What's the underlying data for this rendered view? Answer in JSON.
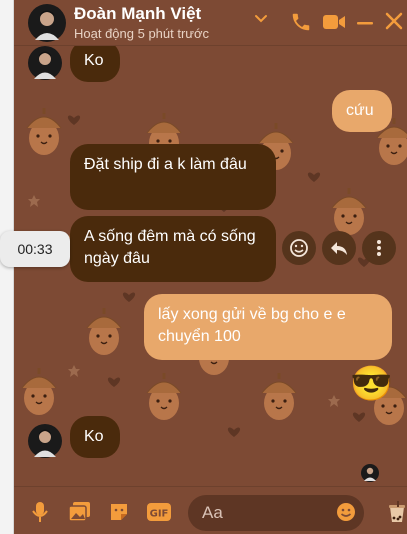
{
  "header": {
    "name": "Đoàn Mạnh Việt",
    "status": "Hoạt động 5 phút trước"
  },
  "colors": {
    "background": "#7d4a34",
    "incoming_bubble": "#4a2a0c",
    "outgoing_bubble": "#e8a86b",
    "accent": "#f39c3c"
  },
  "messages": [
    {
      "direction": "in",
      "text": "Ko"
    },
    {
      "direction": "out",
      "text": "cứu"
    },
    {
      "direction": "in",
      "text": "Đặt ship đi a k làm đâu"
    },
    {
      "direction": "in",
      "text": "A sống đêm mà có sống ngày đâu"
    },
    {
      "direction": "out",
      "text": "lấy xong gửi về bg cho e e chuyển 100"
    },
    {
      "direction": "out",
      "text": "😎",
      "type": "emoji"
    },
    {
      "direction": "in",
      "text": "Ko"
    }
  ],
  "tooltip": {
    "time": "00:33"
  },
  "composer": {
    "placeholder": "Aa"
  }
}
